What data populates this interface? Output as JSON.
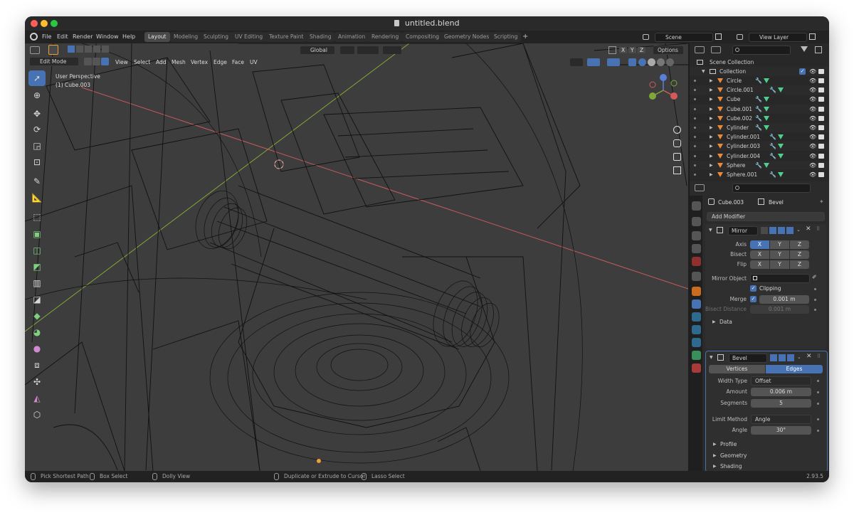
{
  "window": {
    "title": "untitled.blend"
  },
  "menu": {
    "items": [
      "File",
      "Edit",
      "Render",
      "Window",
      "Help"
    ]
  },
  "workspaces": {
    "tabs": [
      "Layout",
      "Modeling",
      "Sculpting",
      "UV Editing",
      "Texture Paint",
      "Shading",
      "Animation",
      "Rendering",
      "Compositing",
      "Geometry Nodes",
      "Scripting"
    ],
    "active": "Layout",
    "add": "+"
  },
  "scene": {
    "name": "Scene",
    "view_layer": "View Layer"
  },
  "viewport": {
    "mode": "Edit Mode",
    "menus": [
      "View",
      "Select",
      "Add",
      "Mesh",
      "Vertex",
      "Edge",
      "Face",
      "UV"
    ],
    "transform_orientation": "Global",
    "axis_labels": [
      "X",
      "Y",
      "Z"
    ],
    "options_label": "Options",
    "perspective_text": "User Perspective",
    "object_text": "(1) Cube.003",
    "colors": {
      "background": "#3d3d3d",
      "x_axis": "#c85a5a",
      "y_axis": "#7fa838",
      "wire": "#111111"
    }
  },
  "toolbar": {
    "tools": [
      "select-box-icon",
      "cursor-icon",
      "move-icon",
      "rotate-icon",
      "scale-icon",
      "transform-icon",
      "annotate-icon",
      "measure-icon",
      "add-cube-icon",
      "extrude-icon",
      "inset-icon",
      "bevel-icon",
      "loop-cut-icon",
      "knife-icon",
      "poly-build-icon",
      "spin-icon",
      "smooth-icon",
      "edge-slide-icon",
      "shrink-icon",
      "shear-icon",
      "rip-icon"
    ]
  },
  "outliner": {
    "root": "Scene Collection",
    "collection": "Collection",
    "items": [
      "Circle",
      "Circle.001",
      "Cube",
      "Cube.001",
      "Cube.002",
      "Cylinder",
      "Cylinder.001",
      "Cylinder.003",
      "Cylinder.004",
      "Sphere",
      "Sphere.001"
    ]
  },
  "properties": {
    "object_name": "Cube.003",
    "modifier_name": "Bevel",
    "add_modifier": "Add Modifier",
    "mirror": {
      "name": "Mirror",
      "axis_label": "Axis",
      "bisect_label": "Bisect",
      "flip_label": "Flip",
      "axes": [
        "X",
        "Y",
        "Z"
      ],
      "mirror_object_label": "Mirror Object",
      "clipping_label": "Clipping",
      "merge_label": "Merge",
      "merge_value": "0.001 m",
      "bisect_distance_label": "Bisect Distance",
      "bisect_distance_value": "0.001 m",
      "data_label": "Data"
    },
    "bevel": {
      "name": "Bevel",
      "vertices_label": "Vertices",
      "edges_label": "Edges",
      "width_type_label": "Width Type",
      "width_type_value": "Offset",
      "amount_label": "Amount",
      "amount_value": "0.006 m",
      "segments_label": "Segments",
      "segments_value": "5",
      "limit_method_label": "Limit Method",
      "limit_method_value": "Angle",
      "angle_label": "Angle",
      "angle_value": "30°",
      "sections": [
        "Profile",
        "Geometry",
        "Shading"
      ]
    }
  },
  "statusbar": {
    "items": [
      "Pick Shortest Path",
      "Box Select",
      "Dolly View",
      "Duplicate or Extrude to Cursor",
      "Lasso Select"
    ],
    "version": "2.93.5"
  }
}
